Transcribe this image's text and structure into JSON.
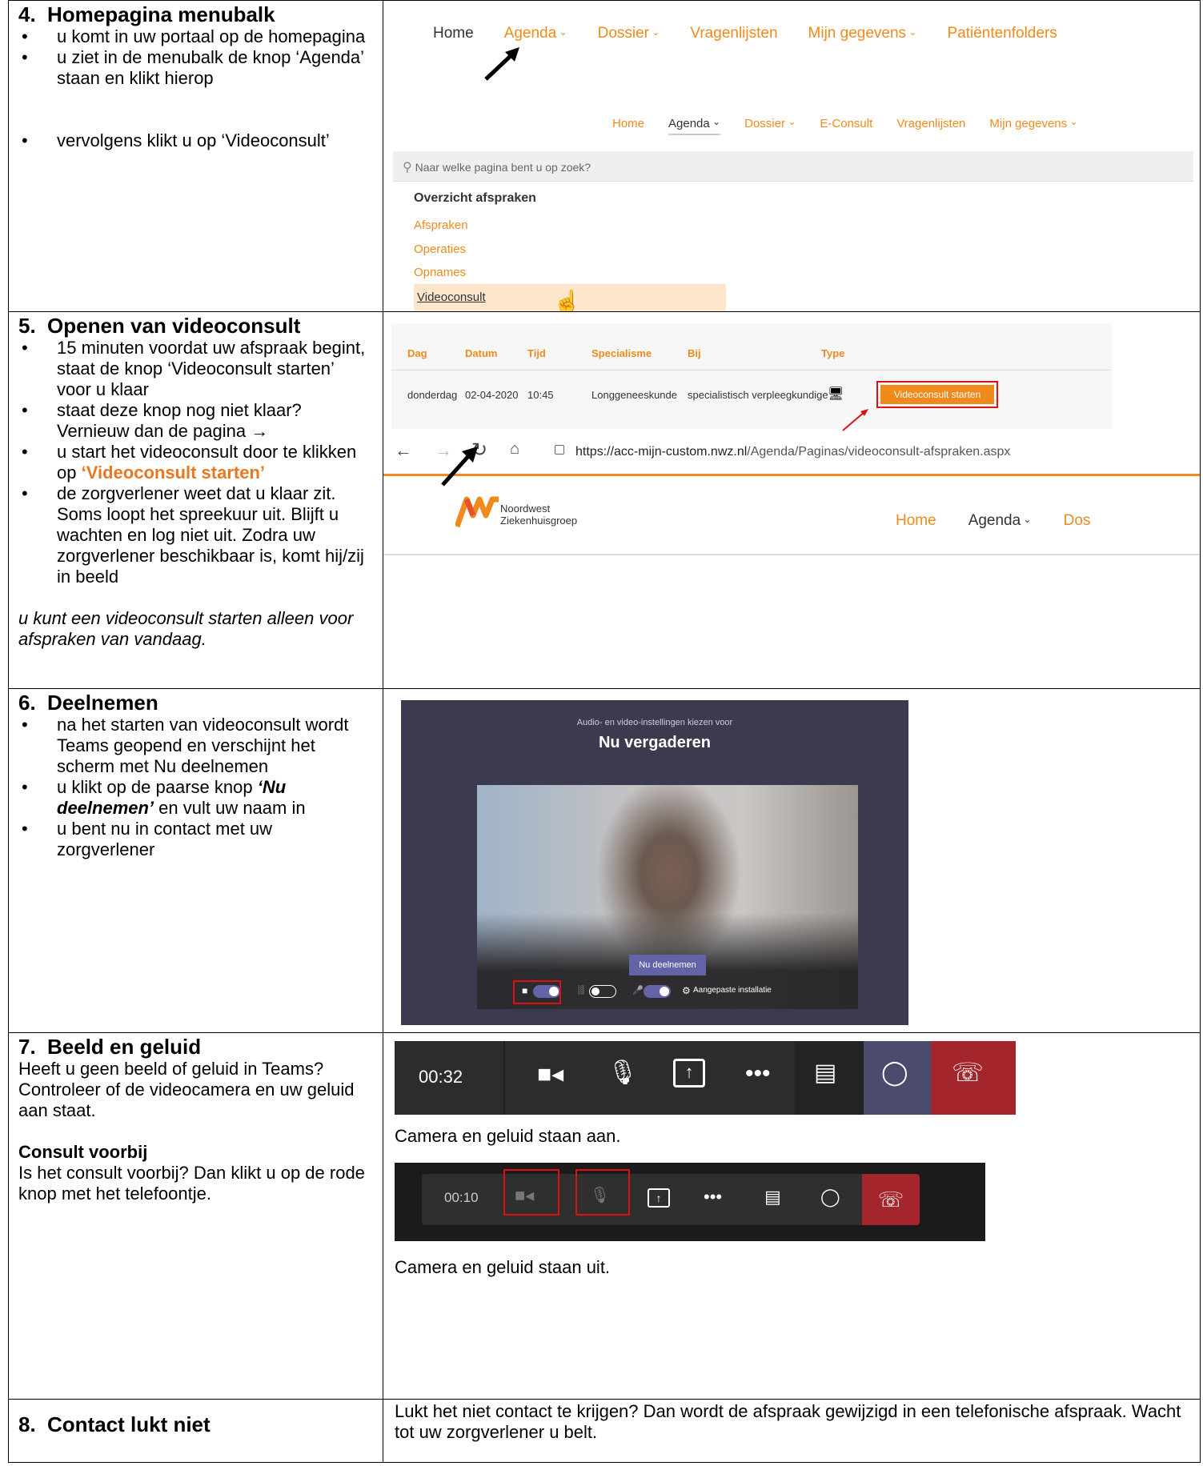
{
  "row4": {
    "num": "4.",
    "title": "Homepagina menubalk",
    "bullets": [
      "u komt in uw portaal op de homepagina",
      "u ziet in de menubalk de knop ‘Agenda’ staan en klikt hierop",
      "vervolgens klikt u op ‘Videoconsult’"
    ],
    "nav_top": [
      "Home",
      "Agenda",
      "Dossier",
      "Vragenlijsten",
      "Mijn gegevens",
      "Patiëntenfolders"
    ],
    "nav_second": [
      "Home",
      "Agenda",
      "Dossier",
      "E-Consult",
      "Vragenlijsten",
      "Mijn gegevens"
    ],
    "search_placeholder": "Naar welke pagina bent u op zoek?",
    "menu_heading": "Overzicht afspraken",
    "menu_items": [
      "Afspraken",
      "Operaties",
      "Opnames",
      "Videoconsult"
    ]
  },
  "row5": {
    "num": "5.",
    "title": "Openen van videoconsult",
    "b1": "15 minuten voordat uw afspraak begint, staat de knop ‘Videoconsult starten’ voor u klaar",
    "b2": "staat deze knop nog niet klaar? Vernieuw dan de pagina →",
    "b3_pre": "u start het videoconsult door te klikken op ",
    "b3_em": "‘Videoconsult starten’",
    "b4": "de zorgverlener weet dat u klaar zit. Soms loopt het spreekuur uit. Blijft u wachten en log niet uit. Zodra uw zorgverlener beschikbaar is, komt hij/zij in beeld",
    "note": "u kunt een videoconsult starten alleen voor afspraken van vandaag.",
    "table_headers": [
      "Dag",
      "Datum",
      "Tijd",
      "Specialisme",
      "Bij",
      "Type"
    ],
    "table_row": [
      "donderdag",
      "02-04-2020",
      "10:45",
      "Longgeneeskunde",
      "specialistisch verpleegkundige"
    ],
    "start_button": "Videoconsult starten",
    "url_host": "https://acc-mijn-custom.nwz.nl",
    "url_path": "/Agenda/Paginas/videoconsult-afspraken.aspx",
    "logo_line1": "Noordwest",
    "logo_line2": "Ziekenhuisgroep",
    "site_nav": [
      "Home",
      "Agenda",
      "Dos"
    ]
  },
  "row6": {
    "num": "6.",
    "title": "Deelnemen",
    "b1": "na het starten van videoconsult wordt Teams geopend en verschijnt het scherm met Nu deelnemen",
    "b2_pre": "u klikt op de paarse knop ",
    "b2_em": "‘Nu deelnemen’",
    "b2_post": " en vult uw naam in",
    "b3": "u bent nu in contact met uw zorgverlener",
    "teams_subtitle": "Audio- en video-instellingen kiezen voor",
    "teams_title": "Nu vergaderen",
    "join_button": "Nu deelnemen",
    "custom_setup": "Aangepaste installatie"
  },
  "row7": {
    "num": "7.",
    "title": "Beeld en geluid",
    "text": "Heeft u geen beeld of geluid in Teams? Controleer of de videocamera en uw geluid aan staat.",
    "sub_title": "Consult voorbij",
    "sub_text": "Is het consult voorbij? Dan klikt u op de rode knop met het telefoontje.",
    "timer_on": "00:32",
    "caption_on": "Camera en geluid staan aan.",
    "timer_off": "00:10",
    "caption_off": "Camera en geluid staan uit."
  },
  "row8": {
    "num": "8.",
    "title": "Contact lukt niet",
    "text": "Lukt het niet contact te krijgen? Dan wordt de afspraak gewijzigd in een telefonische afspraak. Wacht tot uw zorgverlener u belt."
  },
  "colors": {
    "brand_orange": "#f08a1c",
    "teams_purple": "#6264a7",
    "hangup_red": "#a4262c",
    "highlight_red": "#dd1111"
  }
}
